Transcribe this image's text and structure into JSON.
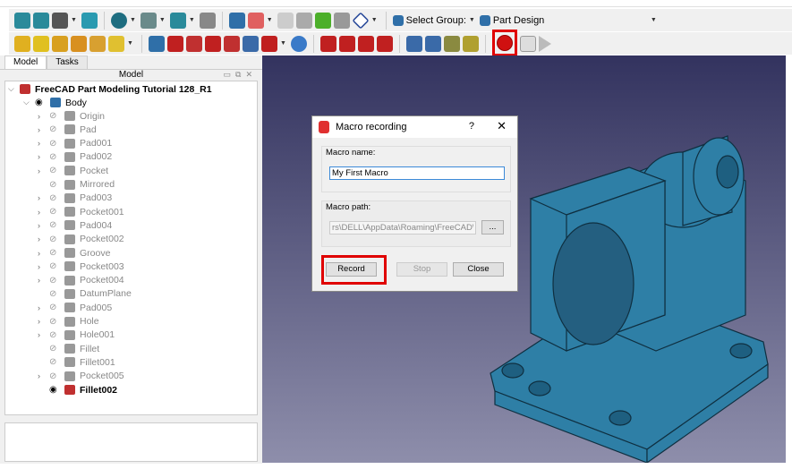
{
  "toolbar": {
    "select_group": "Select Group:",
    "workbench": "Part Design",
    "icons_row1": [
      "zoom-fit-all-icon",
      "zoom-fit-selection-icon",
      "view-iso-icon",
      "sketch-view-icon",
      "draw-style-icon",
      "std-views-icon",
      "measure-icon",
      "measure-tool-icon",
      "part-icon",
      "link-icon",
      "link-sub-icon",
      "person-icon",
      "green-shape-icon",
      "shape-icon",
      "datum-icon"
    ],
    "icons_row2": [
      "pad-icon",
      "revolution-icon",
      "additive-loft-icon",
      "additive-pipe-icon",
      "additive-helix-icon",
      "additive-primitive-icon",
      "pocket-icon",
      "hole-icon",
      "groove-icon",
      "subtractive-loft-icon",
      "subtractive-pipe-icon",
      "subtractive-helix-icon",
      "subtractive-primitive-icon",
      "boolean-icon",
      "fillet-icon",
      "chamfer-icon",
      "draft-icon",
      "thickness-icon",
      "mirrored-icon",
      "linear-pattern-icon",
      "polar-pattern-icon",
      "multitransform-icon",
      "record-macro-icon",
      "macro-editor-icon",
      "execute-macro-icon"
    ]
  },
  "panel": {
    "tabs": [
      "Model",
      "Tasks"
    ],
    "header": "Model"
  },
  "tree": {
    "root": "FreeCAD Part Modeling Tutorial 128_R1",
    "body": "Body",
    "items": [
      {
        "label": "Origin",
        "expand": true
      },
      {
        "label": "Pad",
        "expand": true
      },
      {
        "label": "Pad001",
        "expand": true
      },
      {
        "label": "Pad002",
        "expand": true
      },
      {
        "label": "Pocket",
        "expand": true
      },
      {
        "label": "Mirrored",
        "expand": false
      },
      {
        "label": "Pad003",
        "expand": true
      },
      {
        "label": "Pocket001",
        "expand": true
      },
      {
        "label": "Pad004",
        "expand": true
      },
      {
        "label": "Pocket002",
        "expand": true
      },
      {
        "label": "Groove",
        "expand": true
      },
      {
        "label": "Pocket003",
        "expand": true
      },
      {
        "label": "Pocket004",
        "expand": true
      },
      {
        "label": "DatumPlane",
        "expand": false
      },
      {
        "label": "Pad005",
        "expand": true
      },
      {
        "label": "Hole",
        "expand": true
      },
      {
        "label": "Hole001",
        "expand": true
      },
      {
        "label": "Fillet",
        "expand": false
      },
      {
        "label": "Fillet001",
        "expand": false
      },
      {
        "label": "Pocket005",
        "expand": true
      },
      {
        "label": "Fillet002",
        "expand": false,
        "visible": true
      }
    ]
  },
  "dialog": {
    "title": "Macro recording",
    "help": "?",
    "close": "✕",
    "name_label": "Macro name:",
    "name_value": "My First Macro",
    "path_label": "Macro path:",
    "path_value": "rs\\DELL\\AppData\\Roaming\\FreeCAD\\Macro\\",
    "browse": "...",
    "record": "Record",
    "stop": "Stop",
    "close_btn": "Close"
  },
  "colors": {
    "model": "#2e7fa6",
    "highlight": "#e00000"
  }
}
